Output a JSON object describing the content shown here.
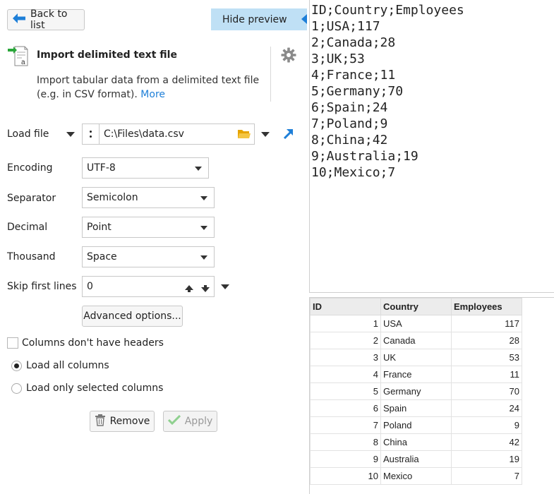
{
  "toolbar": {
    "back_label": "Back to list",
    "hide_preview_label": "Hide preview"
  },
  "header": {
    "title": "Import delimited text file",
    "desc_line1": "Import tabular data from a delimited text file",
    "desc_line2": "(e.g. in CSV format).",
    "more_link": "More"
  },
  "form": {
    "load_file": {
      "label": "Load file",
      "value": "C:\\Files\\data.csv"
    },
    "encoding": {
      "label": "Encoding",
      "value": "UTF-8"
    },
    "separator": {
      "label": "Separator",
      "value": "Semicolon"
    },
    "decimal": {
      "label": "Decimal",
      "value": "Point"
    },
    "thousand": {
      "label": "Thousand",
      "value": "Space"
    },
    "skip": {
      "label": "Skip first lines",
      "value": "0"
    },
    "advanced_label": "Advanced options...",
    "no_headers_label": "Columns don't have headers",
    "load_all_label": "Load all columns",
    "load_selected_label": "Load only selected columns",
    "remove_label": "Remove",
    "apply_label": "Apply"
  },
  "raw_lines": [
    "ID;Country;Employees",
    "1;USA;117",
    "2;Canada;28",
    "3;UK;53",
    "4;France;11",
    "5;Germany;70",
    "6;Spain;24",
    "7;Poland;9",
    "8;China;42",
    "9;Australia;19",
    "10;Mexico;7"
  ],
  "grid": {
    "headers": [
      "ID",
      "Country",
      "Employees"
    ],
    "rows": [
      [
        "1",
        "USA",
        "117"
      ],
      [
        "2",
        "Canada",
        "28"
      ],
      [
        "3",
        "UK",
        "53"
      ],
      [
        "4",
        "France",
        "11"
      ],
      [
        "5",
        "Germany",
        "70"
      ],
      [
        "6",
        "Spain",
        "24"
      ],
      [
        "7",
        "Poland",
        "9"
      ],
      [
        "8",
        "China",
        "42"
      ],
      [
        "9",
        "Australia",
        "19"
      ],
      [
        "10",
        "Mexico",
        "7"
      ]
    ]
  },
  "colors": {
    "accent": "#1e7fd8",
    "preview_button": "#bfe0f5",
    "folder": "#f4b400"
  }
}
